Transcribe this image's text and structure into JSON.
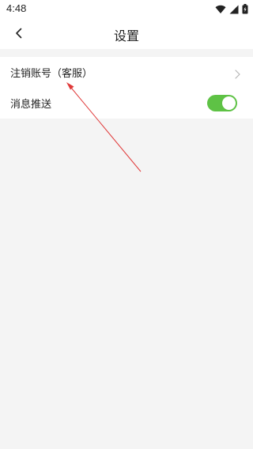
{
  "status_bar": {
    "time": "4:48",
    "icons": [
      "wifi-icon",
      "signal-icon",
      "battery-icon"
    ]
  },
  "header": {
    "title": "设置",
    "back_icon": "chevron-left-icon"
  },
  "settings": {
    "items": [
      {
        "label": "注销账号（客服）",
        "control": "chevron-right-icon"
      },
      {
        "label": "消息推送",
        "control": "toggle",
        "toggle_on": true
      }
    ]
  },
  "colors": {
    "toggle_on": "#5ec245",
    "annotation_arrow": "#e03a3a",
    "background": "#f4f4f4"
  }
}
